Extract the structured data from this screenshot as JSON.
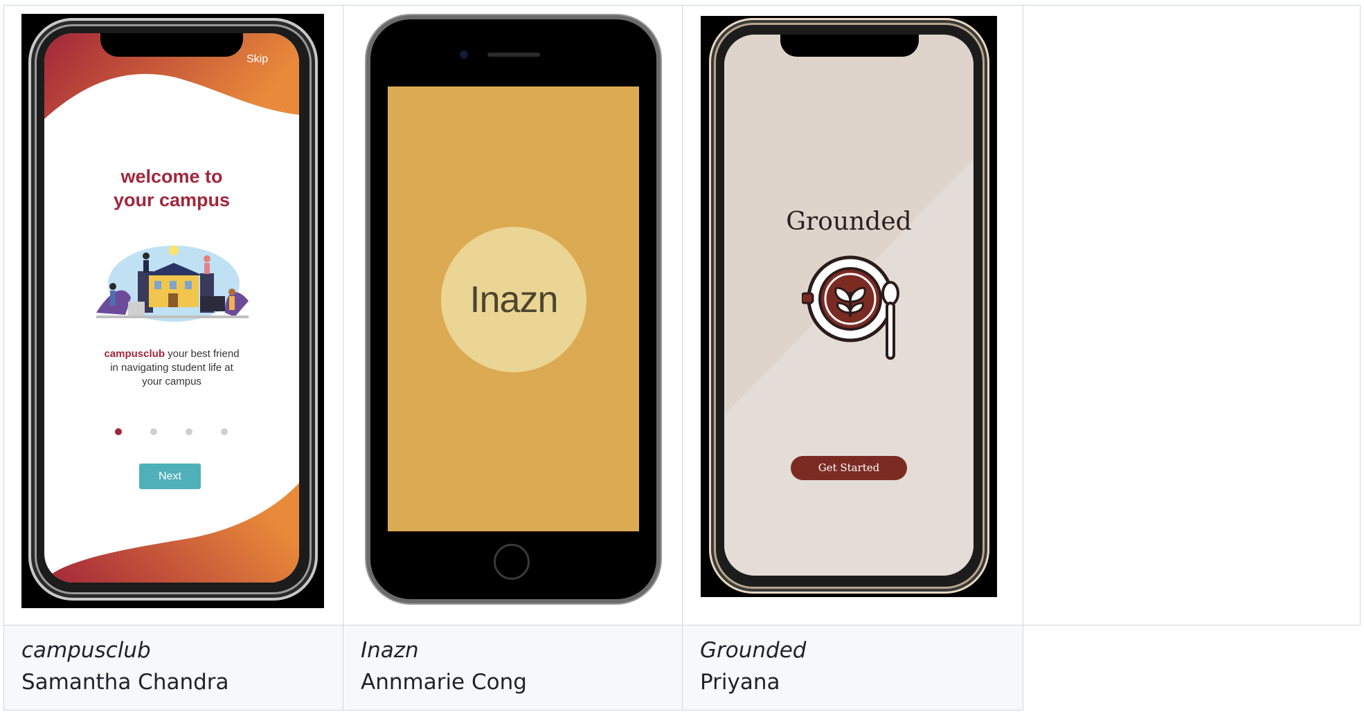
{
  "cards": [
    {
      "title": "campusclub",
      "author": "Samantha Chandra",
      "screen": {
        "skip_label": "Skip",
        "heading_line1": "welcome to",
        "heading_line2": "your campus",
        "brand": "campusclub",
        "tagline": " your best friend in navigating student life at your campus",
        "next_label": "Next",
        "pager": {
          "pages": 4,
          "active": 1
        },
        "colors": {
          "accent": "#a3263a",
          "gradient_end": "#e98a3a",
          "button": "#4fb0b9"
        }
      }
    },
    {
      "title": "Inazn",
      "author": "Annmarie Cong",
      "screen": {
        "logo_text": "Inazn",
        "colors": {
          "background": "#dcaa52",
          "circle": "#ead594"
        }
      }
    },
    {
      "title": "Grounded",
      "author": "Priyana",
      "screen": {
        "app_name": "Grounded",
        "button_label": "Get Started",
        "colors": {
          "background": "#e1d7cf",
          "accent": "#7c2b23"
        }
      }
    }
  ]
}
